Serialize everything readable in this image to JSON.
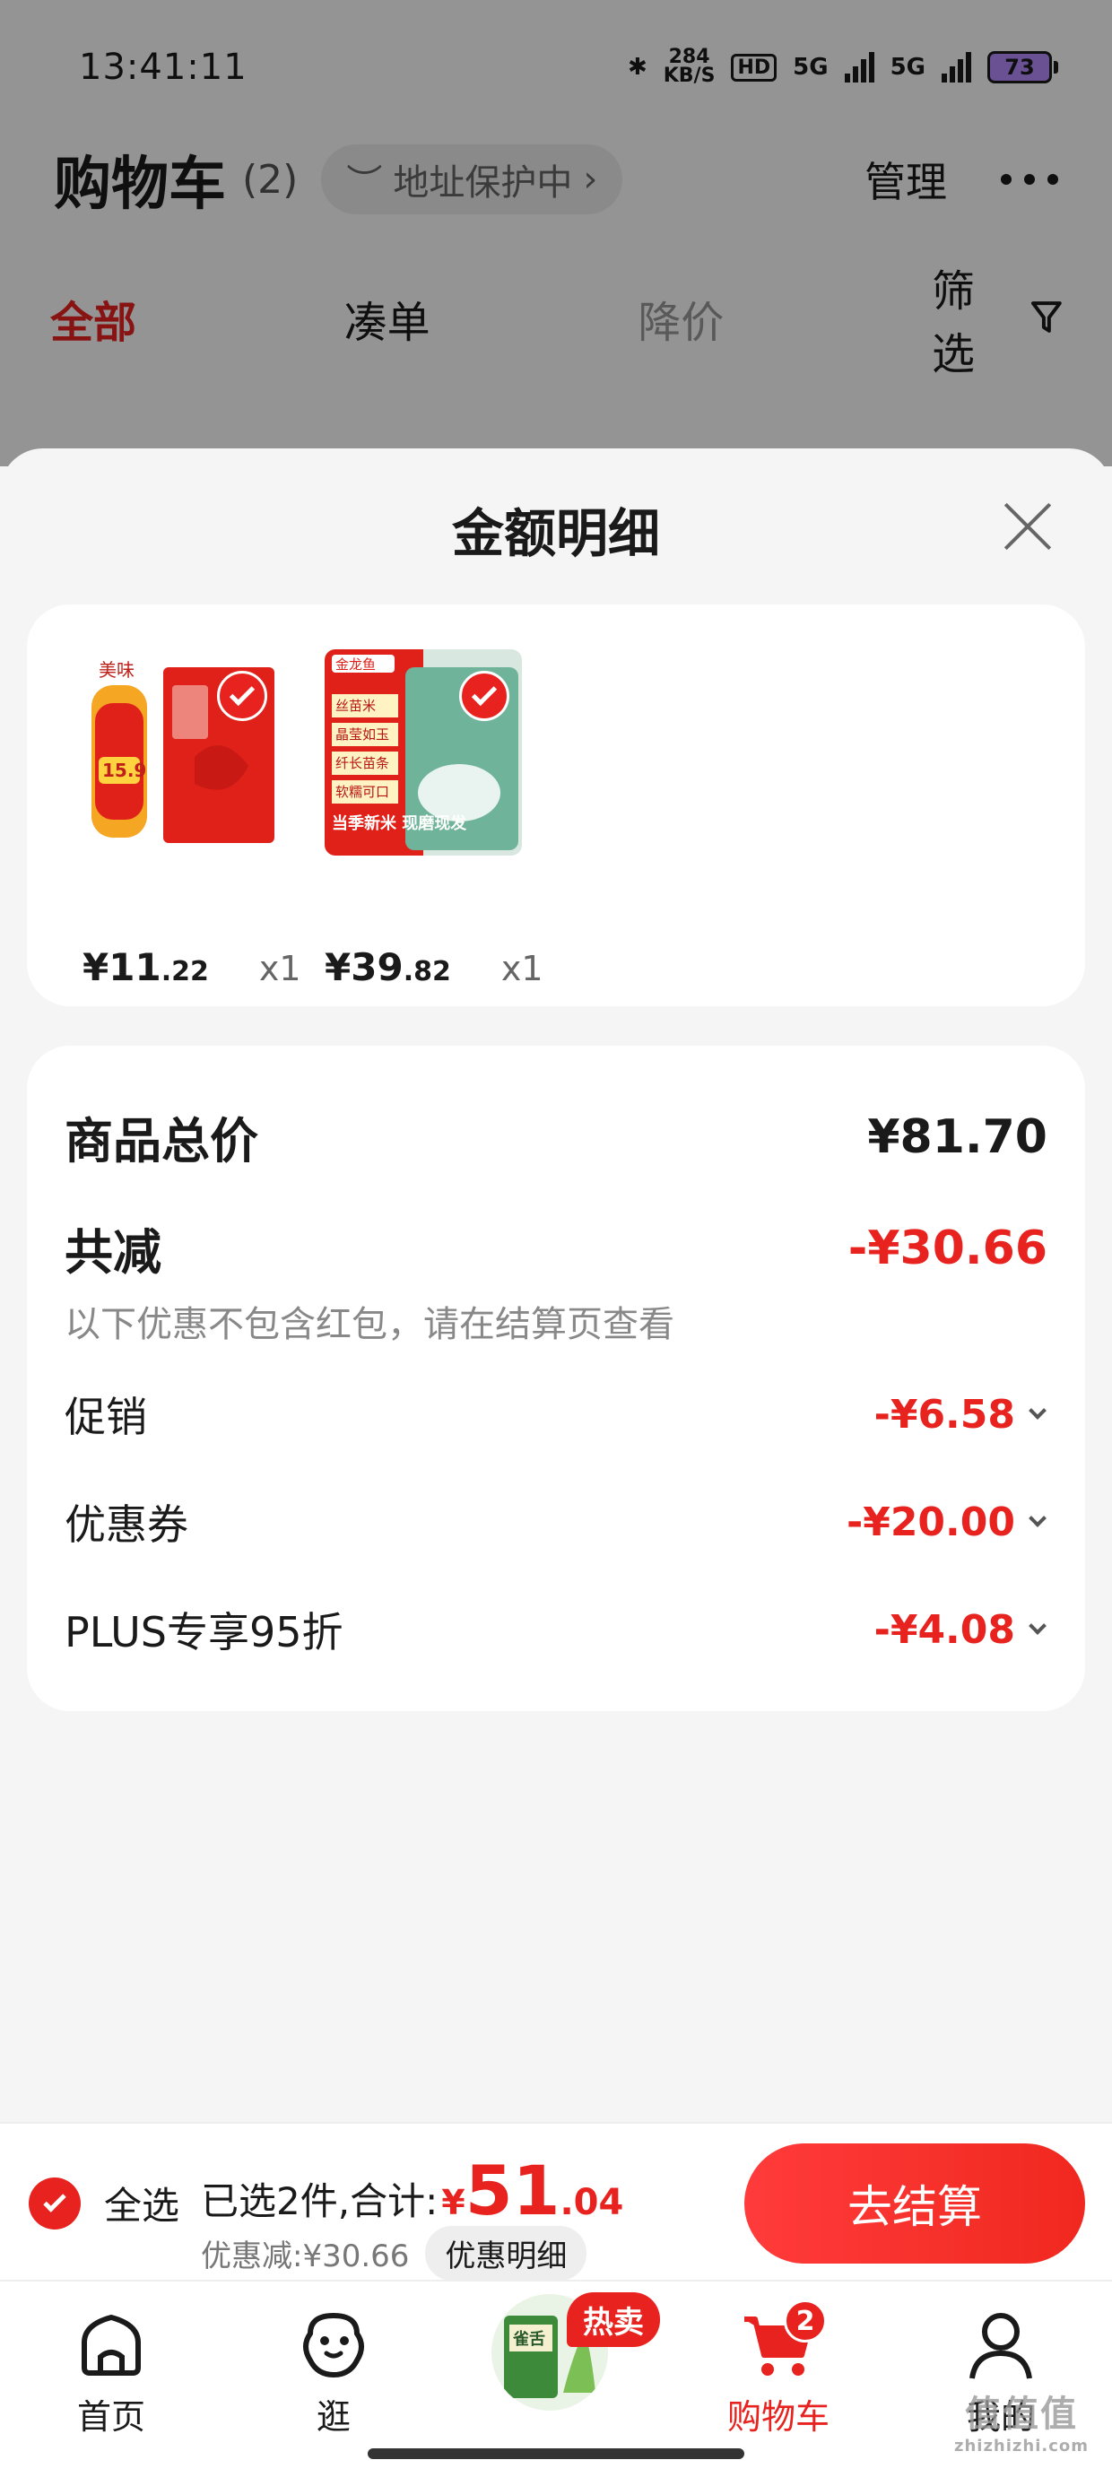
{
  "status_bar": {
    "time": "13:41:11",
    "net_speed_value": "284",
    "net_speed_unit": "KB/S",
    "hd_label": "HD",
    "network_1": "5G",
    "network_2": "5G",
    "battery": "73"
  },
  "header": {
    "title": "购物车",
    "count": "(2)",
    "address_label": "地址保护中",
    "manage_label": "管理"
  },
  "filter_tabs": [
    {
      "label": "全部",
      "active": true
    },
    {
      "label": "凑单",
      "active": false
    },
    {
      "label": "降价",
      "active": false
    }
  ],
  "filter_button": "筛选",
  "sheet": {
    "title": "金额明细",
    "products": [
      {
        "yen": "¥",
        "price_int": "11",
        "price_dec": ".22",
        "qty": "x1",
        "icon": "rice-bag-red-image"
      },
      {
        "yen": "¥",
        "price_int": "39",
        "price_dec": ".82",
        "qty": "x1",
        "icon": "rice-bag-green-image"
      }
    ],
    "product_images": {
      "p1_brand": "美味",
      "p1_tag": "15.9",
      "p2_brand": "金龙鱼",
      "p2_lines": [
        "丝苗米",
        "晶莹如玉",
        "纤长苗条",
        "软糯可口"
      ],
      "p2_banner": "当季新米 现磨现发"
    },
    "summary": {
      "total_label": "商品总价",
      "total_value": "¥81.70",
      "reduce_label": "共减",
      "reduce_value": "-¥30.66",
      "note": "以下优惠不包含红包，请在结算页查看",
      "items": [
        {
          "label": "促销",
          "value": "-¥6.58"
        },
        {
          "label": "优惠券",
          "value": "-¥20.00"
        },
        {
          "label": "PLUS专享95折",
          "value": "-¥4.08"
        }
      ]
    }
  },
  "checkout": {
    "select_all": "全选",
    "selected_text": "已选2件,合计:",
    "total_yen": "¥",
    "total_int": "51",
    "total_dec": ".04",
    "discount_text": "优惠减:¥30.66",
    "detail_button": "优惠明细",
    "checkout_button": "去结算"
  },
  "bottom_nav": {
    "items": [
      {
        "label": "首页",
        "icon": "home-icon"
      },
      {
        "label": "逛",
        "icon": "browse-face-icon"
      },
      {
        "label": "购物车",
        "icon": "cart-icon",
        "active": true
      },
      {
        "label": "我的",
        "icon": "profile-icon"
      }
    ],
    "hot_badge": "热卖",
    "cart_badge": "2",
    "promo_product_text": "雀舌"
  },
  "watermark": {
    "logo": "值值值",
    "url": "zhizhizhi.com"
  },
  "colors": {
    "accent": "#e8231f",
    "background": "#f5f5f5",
    "card": "#ffffff"
  }
}
